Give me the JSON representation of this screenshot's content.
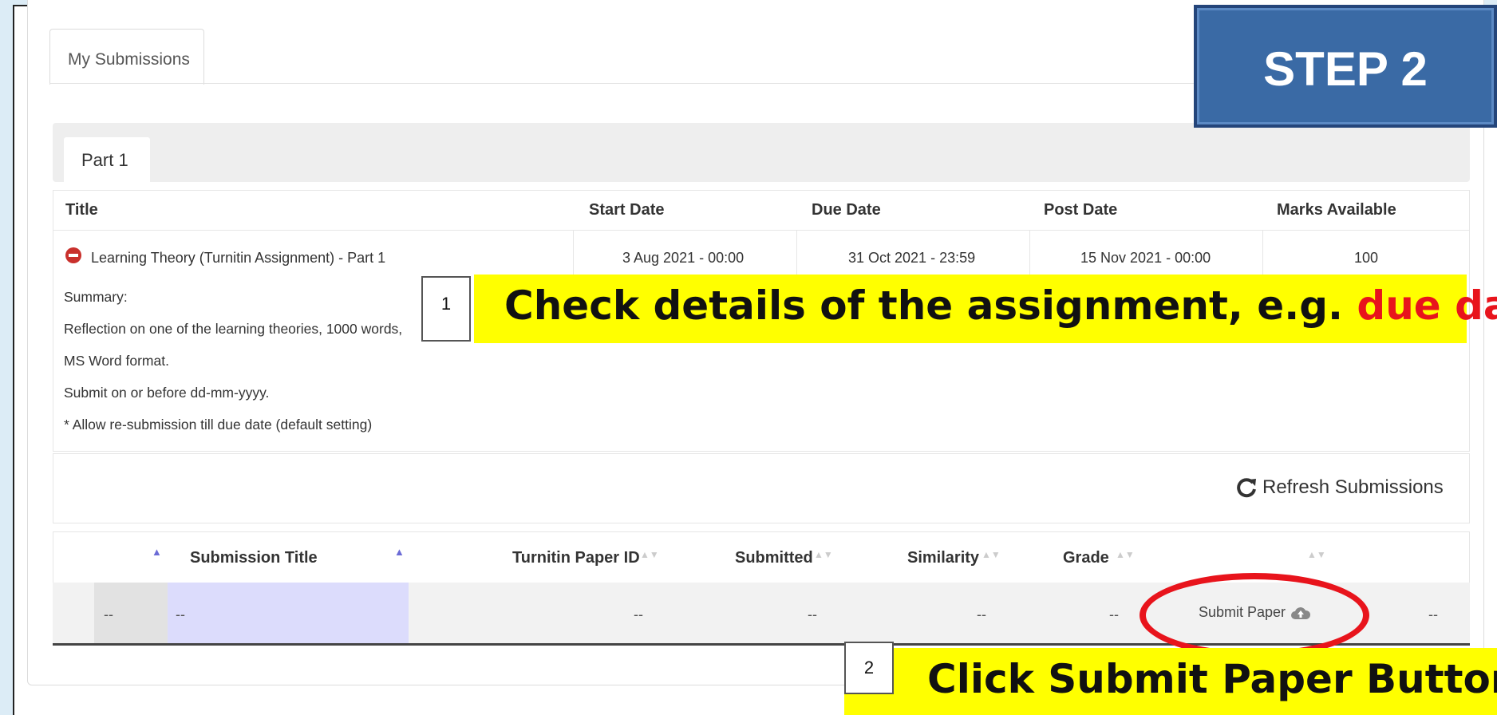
{
  "tabs": {
    "my_submissions": "My Submissions",
    "part": "Part 1"
  },
  "assignment_table": {
    "headers": [
      "Title",
      "Start Date",
      "Due Date",
      "Post Date",
      "Marks Available"
    ],
    "row": {
      "title": "Learning Theory (Turnitin Assignment) - Part 1",
      "start_date": "3 Aug 2021 - 00:00",
      "due_date": "31 Oct 2021 - 23:59",
      "post_date": "15 Nov 2021 - 00:00",
      "marks": "100"
    },
    "summary": [
      "Summary:",
      "Reflection on one of the learning theories, 1000 words,",
      "MS Word format.",
      "Submit on or before dd-mm-yyyy.",
      "* Allow re-submission till due date (default setting)"
    ]
  },
  "refresh": {
    "label": "Refresh Submissions"
  },
  "submissions_table": {
    "headers": {
      "submission_title": "Submission Title",
      "paper_id": "Turnitin Paper ID",
      "submitted": "Submitted",
      "similarity": "Similarity",
      "grade": "Grade"
    },
    "row": {
      "col0": "--",
      "title": "--",
      "paper_id": "--",
      "submitted": "--",
      "similarity": "--",
      "grade": "--",
      "submit_label": "Submit Paper",
      "last": "--"
    }
  },
  "annotations": {
    "step": "STEP 2",
    "callout1_num": "1",
    "callout1_text": "Check details of the assignment, e.g. ",
    "callout1_highlight": "due date",
    "callout1_end": ".",
    "callout2_num": "2",
    "callout2_text": "Click Submit Paper Button"
  },
  "colors": {
    "step_bg": "#3a6aa5",
    "callout_bg": "#ffff00",
    "highlight": "#e8141c",
    "oval": "#e8141c"
  }
}
